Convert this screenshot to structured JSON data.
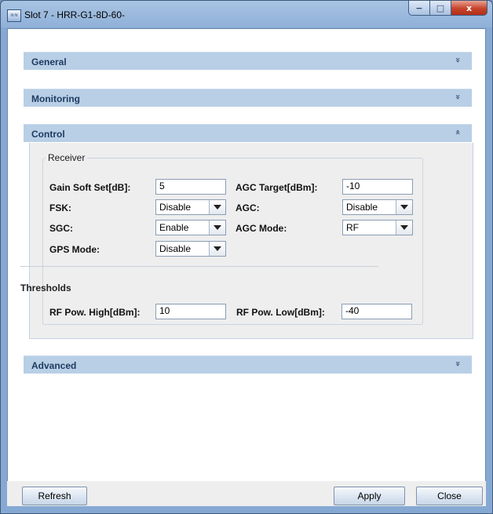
{
  "window": {
    "title": "Slot 7 - HRR-G1-8D-60-",
    "icon_text": "≋≋",
    "minimize": "−",
    "maximize": "□",
    "close": "x"
  },
  "panels": {
    "general": {
      "label": "General",
      "chevron": "»"
    },
    "monitoring": {
      "label": "Monitoring",
      "chevron": "»"
    },
    "control": {
      "label": "Control",
      "chevron": "«"
    },
    "advanced": {
      "label": "Advanced",
      "chevron": "»"
    }
  },
  "receiver": {
    "legend": "Receiver",
    "gain_soft_set": {
      "label": "Gain Soft Set[dB]:",
      "value": "5"
    },
    "agc_target": {
      "label": "AGC Target[dBm]:",
      "value": "-10"
    },
    "fsk": {
      "label": "FSK:",
      "value": "Disable"
    },
    "agc": {
      "label": "AGC:",
      "value": "Disable"
    },
    "sgc": {
      "label": "SGC:",
      "value": "Enable"
    },
    "agc_mode": {
      "label": "AGC Mode:",
      "value": "RF"
    },
    "gps_mode": {
      "label": "GPS Mode:",
      "value": "Disable"
    }
  },
  "thresholds": {
    "title": "Thresholds",
    "rf_pow_high": {
      "label": "RF Pow. High[dBm]:",
      "value": "10"
    },
    "rf_pow_low": {
      "label": "RF Pow. Low[dBm]:",
      "value": "-40"
    }
  },
  "buttons": {
    "refresh": "Refresh",
    "apply": "Apply",
    "close": "Close"
  }
}
